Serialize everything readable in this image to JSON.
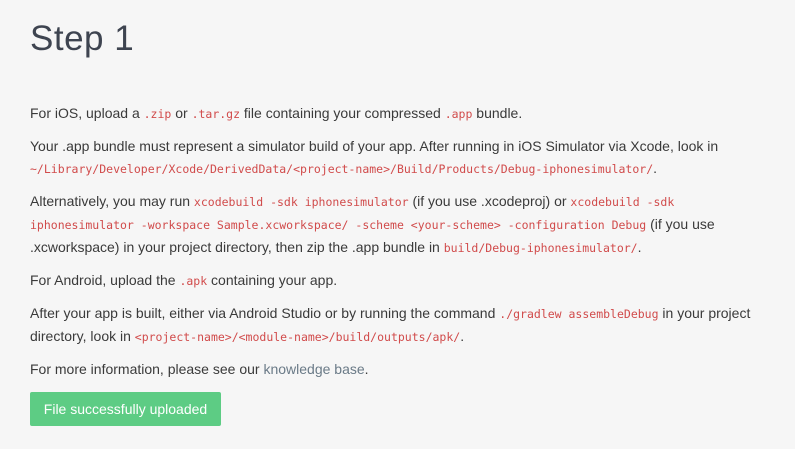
{
  "title": "Step 1",
  "ios": {
    "pre": "For iOS, upload a ",
    "zip": ".zip",
    "or": " or ",
    "targz": ".tar.gz",
    "mid": " file containing your compressed ",
    "app": ".app",
    "post": " bundle."
  },
  "bundle": {
    "pre": "Your .app bundle must represent a simulator build of your app. After running in iOS Simulator via Xcode, look in ",
    "path": "~/Library/Developer/Xcode/DerivedData/<project-name>/Build/Products/Debug-iphonesimulator/",
    "post": "."
  },
  "alt": {
    "pre": "Alternatively, you may run ",
    "cmd1": "xcodebuild -sdk iphonesimulator",
    "mid1": " (if you use .xcodeproj) or ",
    "cmd2": "xcodebuild -sdk iphonesimulator -workspace Sample.xcworkspace/ -scheme <your-scheme> -configuration Debug",
    "mid2": " (if you use .xcworkspace) in your project directory, then zip the .app bundle in ",
    "path": "build/Debug-iphonesimulator/",
    "post": "."
  },
  "android": {
    "pre": "For Android, upload the ",
    "apk": ".apk",
    "post": " containing your app."
  },
  "built": {
    "pre": "After your app is built, either via Android Studio or by running the command ",
    "cmd": "./gradlew assembleDebug",
    "mid": " in your project directory, look in ",
    "path": "<project-name>/<module-name>/build/outputs/apk/",
    "post": "."
  },
  "info": {
    "pre": "For more information, please see our ",
    "link": "knowledge base",
    "post": "."
  },
  "upload_button": "File successfully uploaded",
  "colors": {
    "code": "#d14b4b",
    "button": "#5dcc84",
    "link": "#6a7a87"
  }
}
